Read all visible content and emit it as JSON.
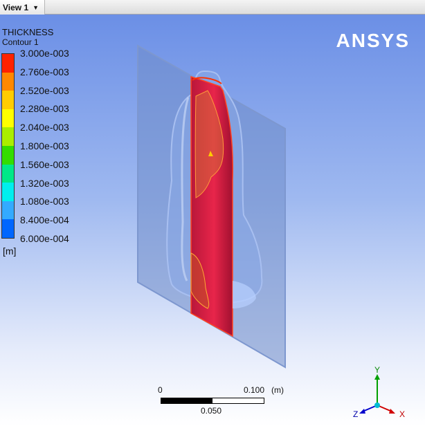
{
  "tab": {
    "label": "View 1"
  },
  "legend": {
    "title": "THICKNESS",
    "subtitle": "Contour 1",
    "labels": [
      "3.000e-003",
      "2.760e-003",
      "2.520e-003",
      "2.280e-003",
      "2.040e-003",
      "1.800e-003",
      "1.560e-003",
      "1.320e-003",
      "1.080e-003",
      "8.400e-004",
      "6.000e-004"
    ],
    "colors": [
      "#ff2200",
      "#ff8800",
      "#ffcc00",
      "#ffff00",
      "#aaee00",
      "#33dd00",
      "#00e888",
      "#00eeee",
      "#33aaff",
      "#0066ff",
      "#0000ff"
    ],
    "unit": "[m]"
  },
  "logo": "ANSYS",
  "scale": {
    "start": "0",
    "end": "0.100",
    "unit": "(m)",
    "mid": "0.050"
  },
  "axes": {
    "x": "X",
    "y": "Y",
    "z": "Z"
  }
}
